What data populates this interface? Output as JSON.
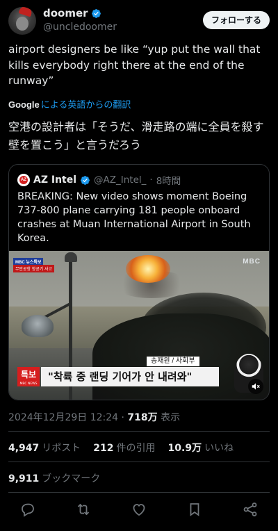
{
  "author": {
    "name": "doomer",
    "handle": "@uncledoomer",
    "follow_label": "フォローする"
  },
  "tweet": {
    "text": "airport designers be like “yup put the wall that kills everybody right there at the end of the runway”",
    "translate_brand": "Google",
    "translate_label": "による英語からの翻訳",
    "translated_text": "空港の設計者は「そうだ、滑走路の端に全員を殺す壁を置こう」と言うだろう"
  },
  "quote": {
    "name": "AZ Intel",
    "handle": "@AZ_Intel_",
    "separator": "·",
    "time": "8時間",
    "text": "BREAKING: New video shows moment Boeing 737-800 plane carrying 181 people onboard crashes at Muan International Airport in South Korea.",
    "media": {
      "mbc_tag1": "MBC 뉴스특보",
      "mbc_tag2": "무안공항 항공기 사고",
      "logo": "MBC",
      "reporter": "송재원 / 사회부",
      "breaking_label": "특보",
      "breaking_sub": "MBC NEWS",
      "headline": "\"착륙 중 랜딩 기어가 안 내려와\""
    }
  },
  "meta": {
    "datetime": "2024年12月29日 12:24",
    "separator": "·",
    "views": "718万",
    "views_label": "表示"
  },
  "stats": {
    "reposts": "4,947",
    "reposts_label": "リポスト",
    "quotes": "212",
    "quotes_label": "件の引用",
    "likes": "10.9万",
    "likes_label": "いいね",
    "bookmarks": "9,911",
    "bookmarks_label": "ブックマーク"
  },
  "colors": {
    "accent": "#1d9bf0",
    "muted": "#71767b",
    "text": "#e7e9ea",
    "border": "#2f3336"
  },
  "icons": [
    "verified-badge-icon",
    "reply-icon",
    "repost-icon",
    "like-icon",
    "bookmark-icon",
    "share-icon",
    "mute-icon"
  ]
}
